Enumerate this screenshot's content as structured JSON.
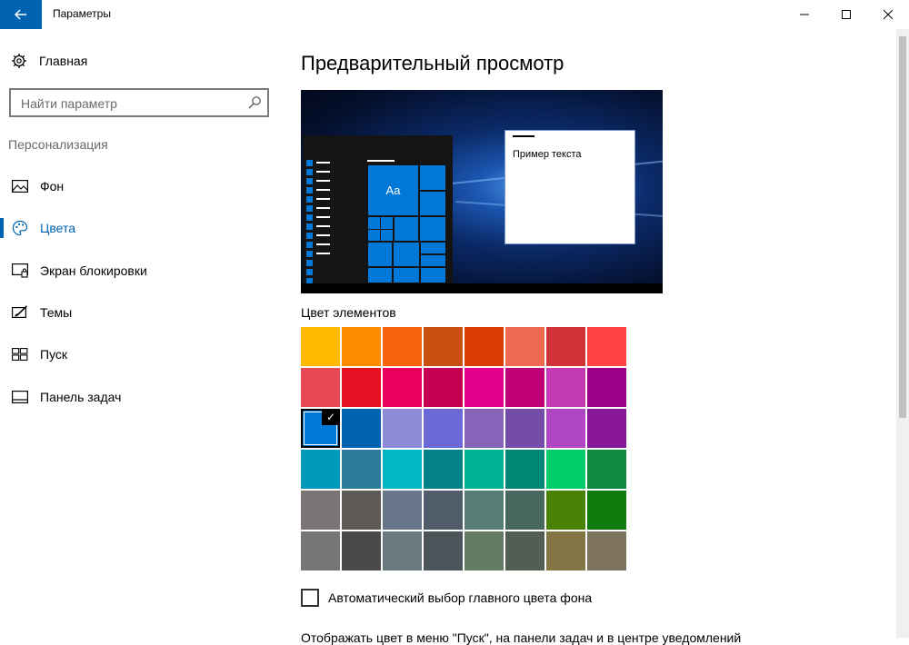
{
  "window": {
    "title": "Параметры"
  },
  "sidebar": {
    "home_label": "Главная",
    "search_placeholder": "Найти параметр",
    "section_label": "Персонализация",
    "items": [
      {
        "label": "Фон",
        "icon": "picture-icon",
        "active": false
      },
      {
        "label": "Цвета",
        "icon": "palette-icon",
        "active": true
      },
      {
        "label": "Экран блокировки",
        "icon": "lock-screen-icon",
        "active": false
      },
      {
        "label": "Темы",
        "icon": "themes-icon",
        "active": false
      },
      {
        "label": "Пуск",
        "icon": "start-icon",
        "active": false
      },
      {
        "label": "Панель задач",
        "icon": "taskbar-icon",
        "active": false
      }
    ]
  },
  "main": {
    "title": "Предварительный просмотр",
    "preview": {
      "sample_text": "Пример текста",
      "tile_label": "Aa"
    },
    "colors_label": "Цвет элементов",
    "selected_color": "#0078d7",
    "swatches": [
      "#ffb900",
      "#ff8c00",
      "#f7630c",
      "#ca5010",
      "#da3b01",
      "#ef6950",
      "#d13438",
      "#ff4343",
      "#e74856",
      "#e81123",
      "#ea005e",
      "#c30052",
      "#e3008c",
      "#bf0077",
      "#c239b3",
      "#9a0089",
      "#0078d7",
      "#0063b1",
      "#8e8cd8",
      "#6b69d6",
      "#8764b8",
      "#744da9",
      "#b146c2",
      "#881798",
      "#0099bc",
      "#2d7d9a",
      "#00b7c3",
      "#038387",
      "#00b294",
      "#018574",
      "#00cc6a",
      "#10893e",
      "#7a7574",
      "#5d5a58",
      "#68768a",
      "#515c6b",
      "#567c73",
      "#486860",
      "#498205",
      "#107c10",
      "#767676",
      "#4c4a48",
      "#69797e",
      "#4a5459",
      "#647c64",
      "#525e54",
      "#847545",
      "#7e735f"
    ],
    "auto_color_label": "Автоматический выбор главного цвета фона",
    "auto_color_checked": false,
    "cut_off_text": "Отображать цвет в меню \"Пуск\", на панели задач и в центре уведомлений"
  }
}
